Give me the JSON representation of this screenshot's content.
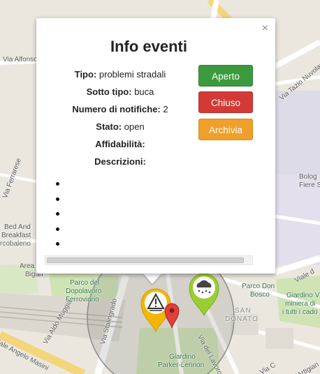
{
  "popup": {
    "title": "Info eventi",
    "close_symbol": "×",
    "fields": [
      {
        "label": "Tipo:",
        "value": "problemi stradali"
      },
      {
        "label": "Sotto tipo:",
        "value": "buca"
      },
      {
        "label": "Numero di notifiche:",
        "value": "2"
      },
      {
        "label": "Stato:",
        "value": "open"
      },
      {
        "label": "Affidabilità:",
        "value": ""
      },
      {
        "label": "Descrizioni:",
        "value": ""
      }
    ],
    "description_bullets": 5,
    "buttons": {
      "aperto": "Aperto",
      "chiuso": "Chiuso",
      "archivia": "Archivia"
    },
    "colors": {
      "aperto": "#3c9a3e",
      "chiuso": "#d33a35",
      "archivia": "#f0a02a"
    }
  },
  "map": {
    "labels": {
      "via_alfonso": "Via Alfonso",
      "via_tazio_nuvolari": "Via Tazio Nuvolari",
      "bologna_fiere": "Bolog",
      "bologna_fiere_2": "Fiere S",
      "ferrarese": "Via Ferrarese",
      "bed_and": "Bed And",
      "breakfast": "Breakfast",
      "arcobaleno": "rcobaleno",
      "area": "Area",
      "bigari": "Bigari",
      "parco_dopolavoro_1": "Parco del",
      "parco_dopolavoro_2": "Dopolavoro",
      "parco_dopolavoro_3": "Ferroviario",
      "via_stalingrado": "Via Stalingrado",
      "viale_a": "Viale d",
      "parco_don_bosco_1": "Parco Don",
      "parco_don_bosco_2": "Bosco",
      "san_donato_1": "SAN",
      "san_donato_2": "DONATO",
      "giardino_1": "Giardino V",
      "giardino_2": "miniera di",
      "giardino_3": "i tutti i cado",
      "giardino_parker_1": "Giardino",
      "giardino_parker_2": "Parker-Lennon",
      "via_aldo_muggia": "Via Aldo Muggia",
      "viale_angelo_masini": "iale Angelo Masini",
      "via_del_lavoro": "Via del Lavoro",
      "via_cesare": "Via C",
      "via_artigiano": "l'Artigian"
    },
    "markers": {
      "hazard_icon": "road-hazard-icon",
      "weather_icon": "snow-weather-icon",
      "location_icon": "red-location-pin-icon"
    },
    "colors": {
      "hazard": "#f2b705",
      "weather": "#9acd32",
      "pin": "#e0403a",
      "radius_circle": "#8a8a8a"
    }
  }
}
